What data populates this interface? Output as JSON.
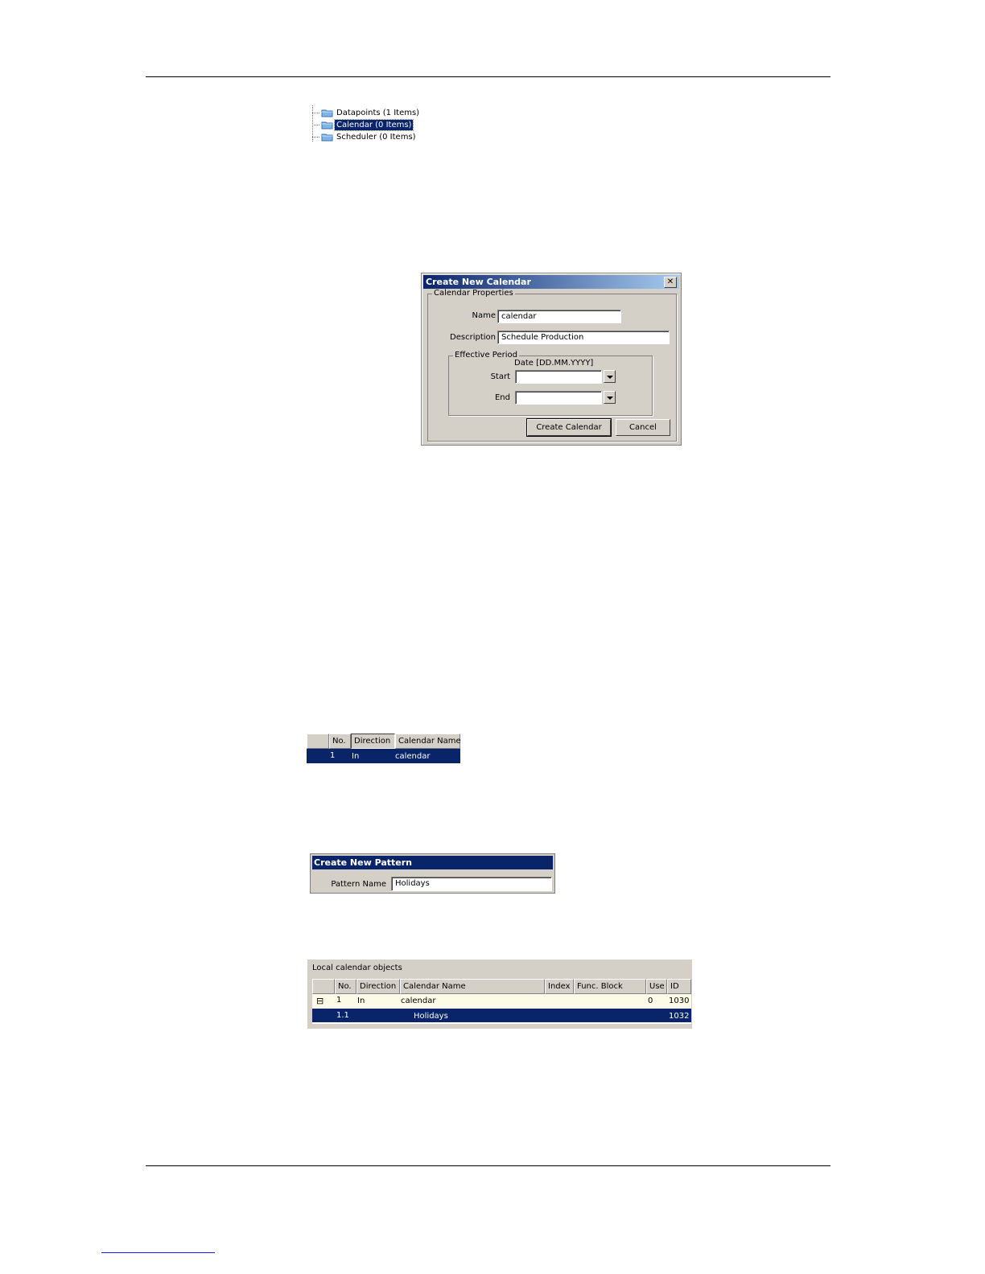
{
  "tree": {
    "items": [
      {
        "label": "Datapoints (1 Items)",
        "selected": false
      },
      {
        "label": "Calendar (0 Items)",
        "selected": true
      },
      {
        "label": "Scheduler (0 Items)",
        "selected": false
      }
    ]
  },
  "create_calendar_dialog": {
    "title": "Create New Calendar",
    "close_glyph": "✕",
    "group_label": "Calendar Properties",
    "name_label": "Name",
    "name_value": "calendar",
    "description_label": "Description",
    "description_value": "Schedule Production",
    "effective_period_label": "Effective Period",
    "date_format_label": "Date [DD.MM.YYYY]",
    "start_label": "Start",
    "start_value": "",
    "end_label": "End",
    "end_value": "",
    "create_button": "Create Calendar",
    "cancel_button": "Cancel"
  },
  "calendar_table": {
    "columns": [
      "No.",
      "Direction",
      "Calendar Name"
    ],
    "row": {
      "no": "1",
      "direction": "In",
      "name": "calendar"
    }
  },
  "create_pattern_dialog": {
    "title": "Create New Pattern",
    "pattern_label": "Pattern Name",
    "pattern_value": "Holidays"
  },
  "local_calendar_objects": {
    "title": "Local calendar objects",
    "columns": [
      "No.",
      "Direction",
      "Calendar Name",
      "Index",
      "Func. Block",
      "Use",
      "ID"
    ],
    "rows": [
      {
        "expander": "⊟",
        "no": "1",
        "direction": "In",
        "name": "calendar",
        "index": "",
        "func_block": "",
        "use": "0",
        "id": "1030"
      },
      {
        "expander": "",
        "no": "1.1",
        "direction": "",
        "name": "Holidays",
        "index": "",
        "func_block": "",
        "use": "",
        "id": "1032"
      }
    ]
  },
  "colors": {
    "selection": "#0a246a",
    "dialog_bg": "#d4d0c8",
    "footer_link": "#1a1aff"
  }
}
